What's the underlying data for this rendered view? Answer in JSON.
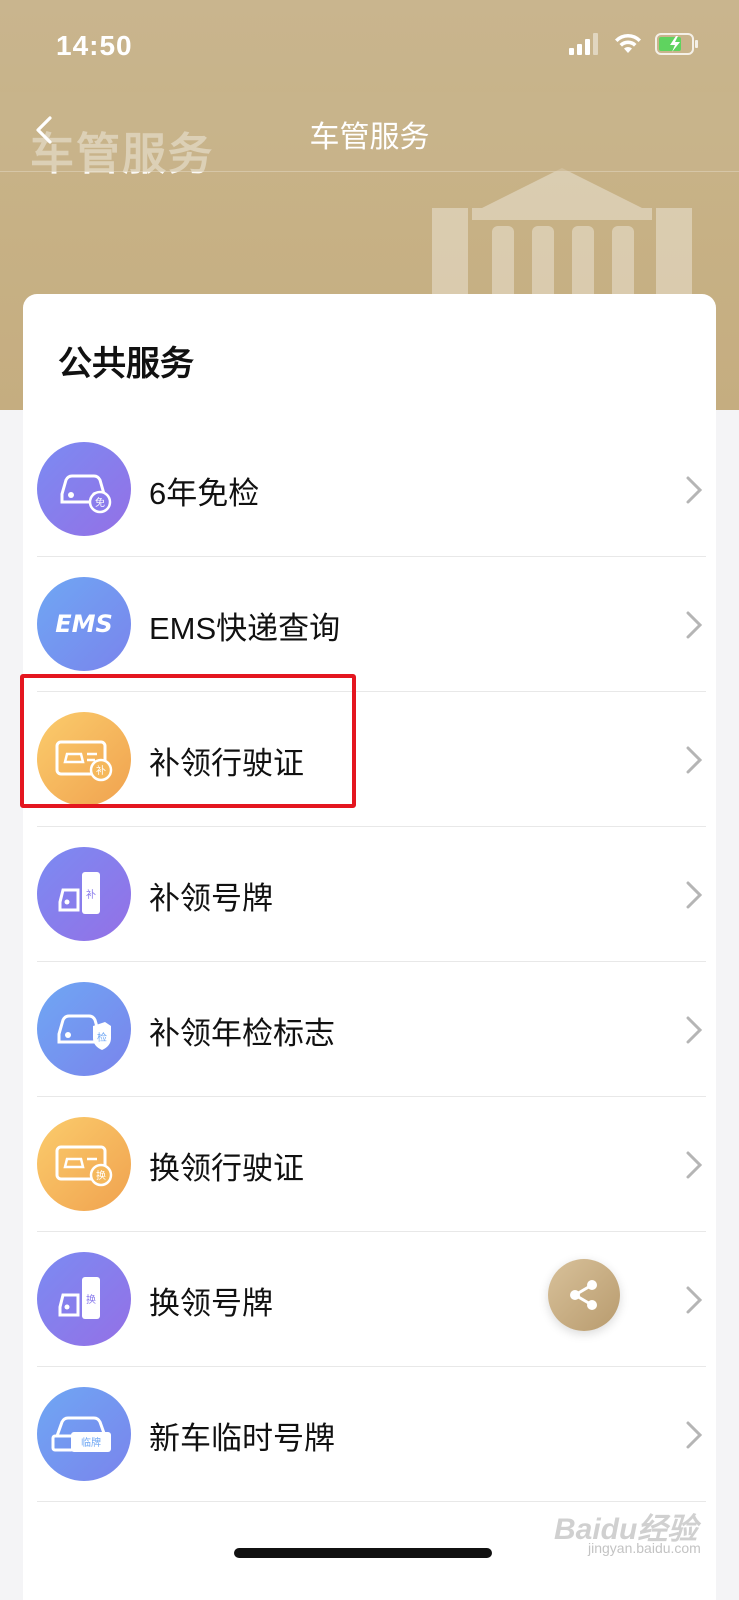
{
  "status_bar": {
    "time": "14:50"
  },
  "nav": {
    "title": "车管服务"
  },
  "hero": {
    "big_title": "车管服务"
  },
  "card": {
    "title": "公共服务"
  },
  "services": [
    {
      "label": "6年免检",
      "icon": "car-exempt-icon",
      "badge": "免",
      "color": "purple"
    },
    {
      "label": "EMS快递查询",
      "icon": "ems-icon",
      "badge": "EMS",
      "color": "blue"
    },
    {
      "label": "补领行驶证",
      "icon": "license-reissue-icon",
      "badge": "补",
      "color": "orange"
    },
    {
      "label": "补领号牌",
      "icon": "plate-reissue-icon",
      "badge": "补",
      "color": "purple"
    },
    {
      "label": "补领年检标志",
      "icon": "inspection-mark-icon",
      "badge": "检",
      "color": "blue"
    },
    {
      "label": "换领行驶证",
      "icon": "license-renew-icon",
      "badge": "换",
      "color": "orange"
    },
    {
      "label": "换领号牌",
      "icon": "plate-renew-icon",
      "badge": "换",
      "color": "purple"
    },
    {
      "label": "新车临时号牌",
      "icon": "temp-plate-icon",
      "badge": "临牌",
      "color": "blue"
    }
  ],
  "watermark": {
    "text": "Baidu经验",
    "sub": "jingyan.baidu.com"
  },
  "colors": {
    "header_gold": "#c7b185",
    "highlight_red": "#e4161f",
    "icon_purple": "#8a7cec",
    "icon_blue": "#6fa7f4",
    "icon_orange": "#f5b85c"
  }
}
